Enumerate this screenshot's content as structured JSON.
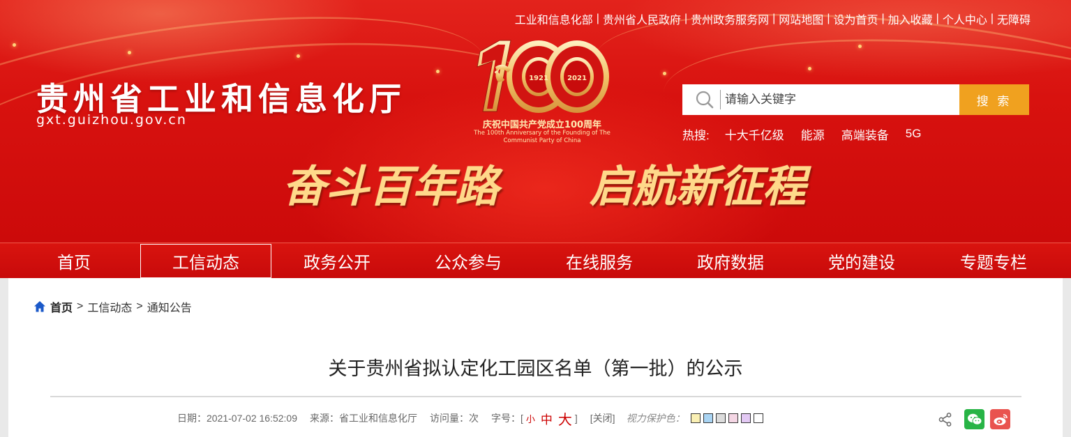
{
  "colors": {
    "header_red": "#d8120f",
    "nav_red": "#cc0a0a",
    "search_button": "#f0a11f",
    "gold_text": "#ffd98a",
    "wechat_green": "#28b446",
    "weibo_red": "#e9534f"
  },
  "top_links": [
    {
      "label": "工业和信息化部"
    },
    {
      "label": "贵州省人民政府"
    },
    {
      "label": "贵州政务服务网"
    },
    {
      "label": "网站地图"
    },
    {
      "label": "设为首页"
    },
    {
      "label": "加入收藏"
    },
    {
      "label": "个人中心"
    },
    {
      "label": "无障碍"
    }
  ],
  "site": {
    "name": "贵州省工业和信息化厅",
    "url": "gxt.guizhou.gov.cn"
  },
  "anniversary": {
    "years": [
      "1921",
      "2021"
    ],
    "caption_cn": "庆祝中国共产党成立100周年",
    "caption_en": "The 100th Anniversary of the Founding of The Communist Party of China"
  },
  "slogan": [
    "奋斗百年路",
    "启航新征程"
  ],
  "search": {
    "placeholder": "请输入关键字",
    "button_label": "搜 索",
    "icon": "search-icon"
  },
  "hot": {
    "label": "热搜:",
    "items": [
      "十大千亿级",
      "能源",
      "高端装备",
      "5G"
    ]
  },
  "nav": {
    "active_index": 1,
    "items": [
      "首页",
      "工信动态",
      "政务公开",
      "公众参与",
      "在线服务",
      "政府数据",
      "党的建设",
      "专题专栏"
    ]
  },
  "breadcrumb": {
    "home": "首页",
    "sep": ">",
    "items": [
      "工信动态",
      "通知公告"
    ]
  },
  "article": {
    "title": "关于贵州省拟认定化工园区名单（第一批）的公示",
    "date_label": "日期：",
    "date": "2021-07-02 16:52:09",
    "source_label": "来源：",
    "source": "省工业和信息化厅",
    "visits_label": "访问量：",
    "visits_unit": "次",
    "font_label": "字号：",
    "bracket_open": "[",
    "bracket_close": "]",
    "font_small": "小",
    "font_mid": "中",
    "font_big": "大",
    "close_label": "[关闭]",
    "eye_label": "视力保护色：",
    "eye_colors": [
      "#faf0b4",
      "#a9d4f3",
      "#dcdcdc",
      "#f4d6e4",
      "#e3c9f4",
      "#ffffff"
    ]
  },
  "share": {
    "icons": [
      "share-icon",
      "wechat-icon",
      "weibo-icon"
    ]
  }
}
